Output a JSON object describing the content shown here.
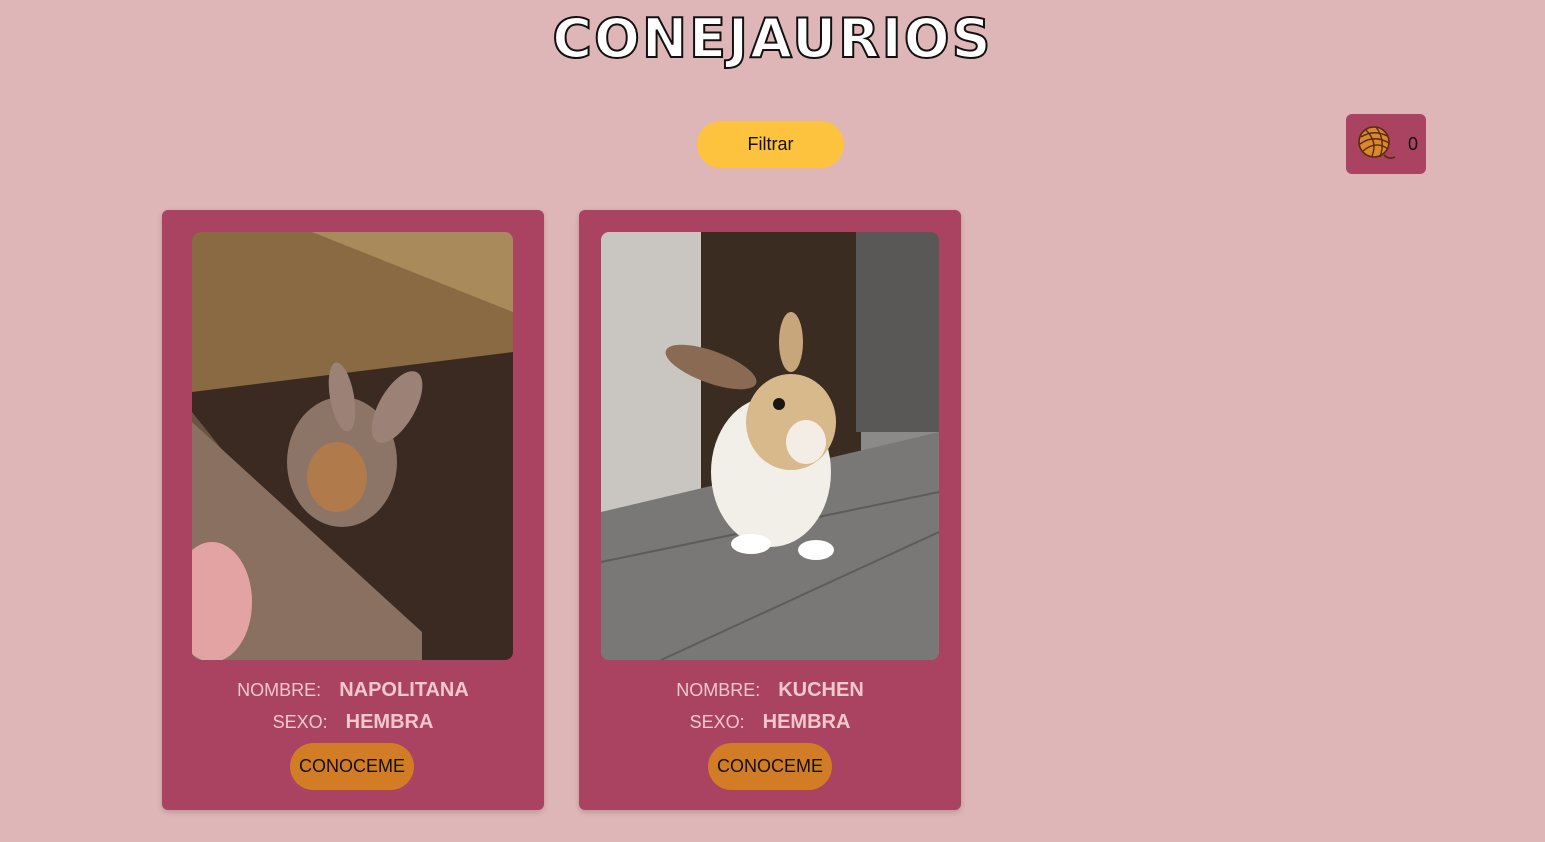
{
  "header": {
    "title": "CONEJAURIOS"
  },
  "toolbar": {
    "filter_label": "Filtrar"
  },
  "cart": {
    "icon": "yarn-ball-icon",
    "count": "0"
  },
  "colors": {
    "background": "#dfb6b7",
    "card": "#aa4362",
    "filter_button": "#fdc23e",
    "meet_button": "#d27d25",
    "label_text": "#f2c8cc"
  },
  "rabbits": [
    {
      "name_label": "NOMBRE:",
      "name": "NAPOLITANA",
      "sex_label": "SEXO:",
      "sex": "HEMBRA",
      "button_label": "CONOCEME"
    },
    {
      "name_label": "NOMBRE:",
      "name": "KUCHEN",
      "sex_label": "SEXO:",
      "sex": "HEMBRA",
      "button_label": "CONOCEME"
    }
  ]
}
